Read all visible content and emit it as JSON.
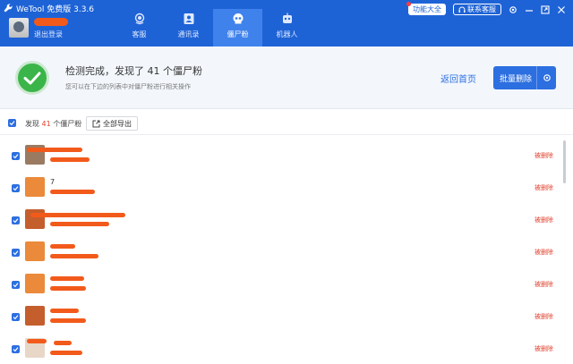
{
  "window": {
    "app_title": "WeTool 免费版 3.3.6",
    "logout_label": "退出登录",
    "features_label": "功能大全",
    "support_label": "联系客服"
  },
  "nav": {
    "items": [
      {
        "label": "客服",
        "icon": "headset-icon"
      },
      {
        "label": "通讯录",
        "icon": "contacts-icon"
      },
      {
        "label": "僵尸粉",
        "icon": "skull-icon"
      },
      {
        "label": "机器人",
        "icon": "robot-icon"
      }
    ],
    "active": "僵尸粉"
  },
  "summary": {
    "title": "检测完成，发现了 41 个僵尸粉",
    "subtitle": "您可以在下边的列表中对僵尸粉进行相关操作",
    "back_home_label": "返回首页",
    "batch_delete_label": "批量删除"
  },
  "toolbar": {
    "found_prefix": "发现",
    "found_count": "41",
    "found_suffix": "个僵尸粉",
    "export_label": "全部导出"
  },
  "list": {
    "rows": [
      {
        "name": "",
        "status": "被删除"
      },
      {
        "name": "7",
        "status": "被删除"
      },
      {
        "name": "",
        "status": "被删除"
      },
      {
        "name": "",
        "status": "被删除"
      },
      {
        "name": "",
        "status": "被删除"
      },
      {
        "name": "",
        "status": "被删除"
      },
      {
        "name": "",
        "status": "被删除"
      }
    ]
  },
  "colors": {
    "primary": "#1e63d6",
    "accent": "#2c6fe0",
    "success": "#3bb54a",
    "danger": "#e0432f",
    "redaction": "#f25a1b"
  }
}
